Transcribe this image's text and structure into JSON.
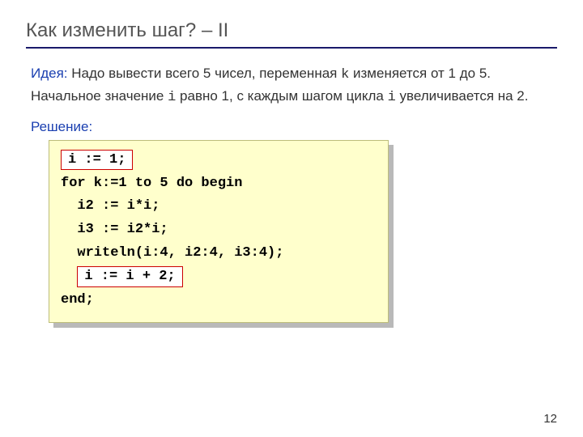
{
  "title": "Как изменить шаг? – II",
  "idea": {
    "label": "Идея:",
    "part1": " Надо вывести всего 5 чисел, переменная ",
    "var_k": "k",
    "part2": " изменяется от 1 до 5. Начальное значение ",
    "var_i": "i",
    "part3": " равно 1, с каждым шагом цикла ",
    "var_i2": "i",
    "part4": " увеличивается на 2."
  },
  "solution_label": "Решение:",
  "code": {
    "line1_hl": "i := 1;",
    "line2": "for k:=1 to 5 do begin",
    "line3": "  i2 := i*i;",
    "line4": "  i3 := i2*i;",
    "line5": "  writeln(i:4, i2:4, i3:4);",
    "line6_hl": "i := i + 2;",
    "line7": "end;"
  },
  "page_number": "12"
}
